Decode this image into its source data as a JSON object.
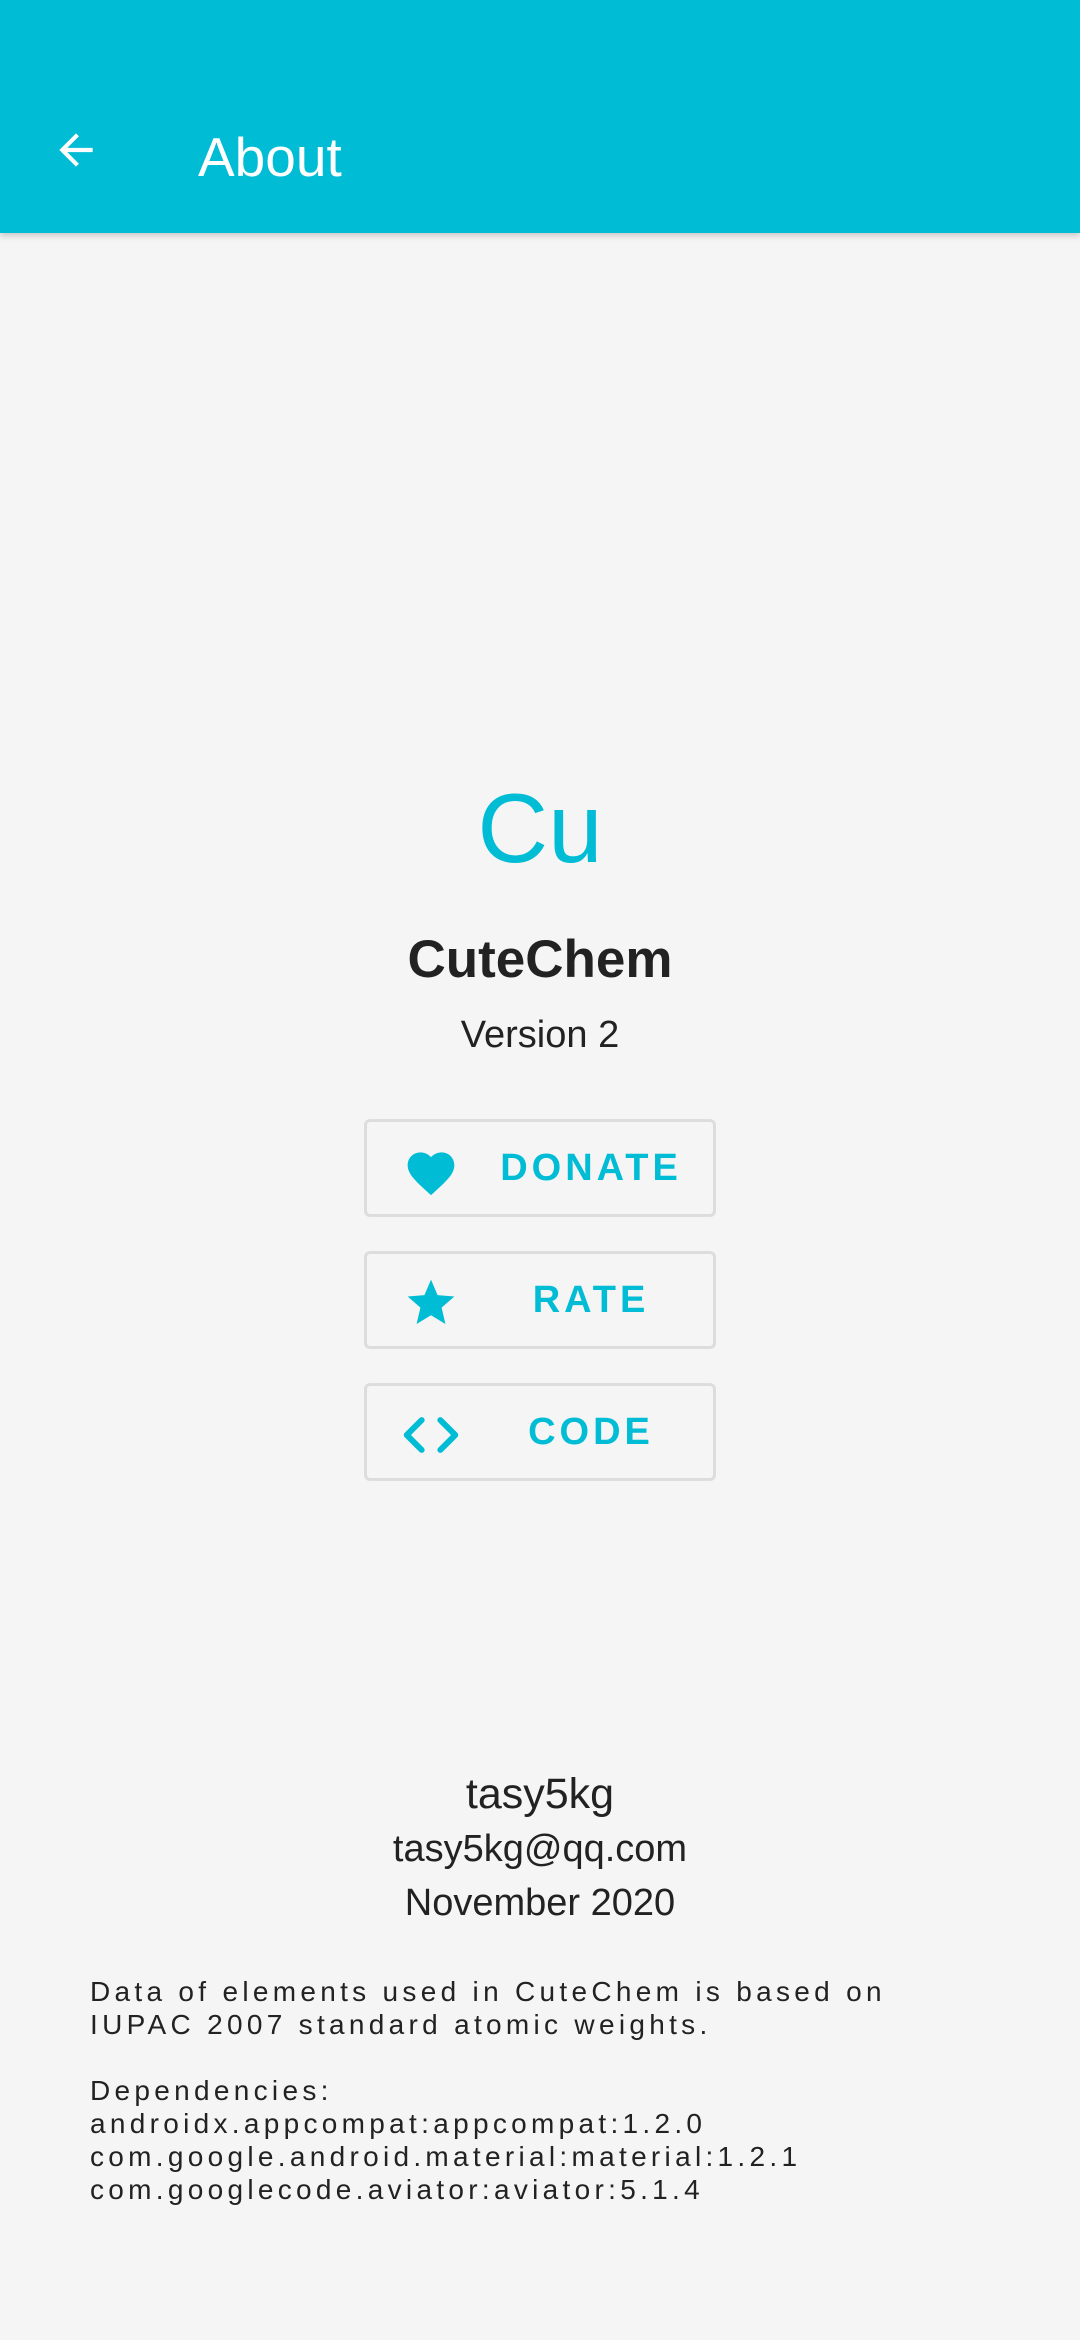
{
  "header": {
    "back_icon": "arrow-left-icon",
    "title": "About",
    "background_color": "#00bcd4"
  },
  "app": {
    "symbol": "Cu",
    "name": "CuteChem",
    "version": "Version 2",
    "accent_color": "#00bcd4"
  },
  "actions": [
    {
      "label": "DONATE",
      "icon": "heart-icon"
    },
    {
      "label": "RATE",
      "icon": "star-icon"
    },
    {
      "label": "CODE",
      "icon": "code-icon"
    }
  ],
  "author": {
    "name": "tasy5kg",
    "email": "tasy5kg@qq.com",
    "date": "November 2020"
  },
  "info": {
    "data_note_line1": "Data of elements used in CuteChem is based on",
    "data_note_line2": "IUPAC 2007 standard atomic weights.",
    "dependencies_label": "Dependencies:",
    "dependencies": [
      "androidx.appcompat:appcompat:1.2.0",
      "com.google.android.material:material:1.2.1",
      "com.googlecode.aviator:aviator:5.1.4"
    ]
  }
}
